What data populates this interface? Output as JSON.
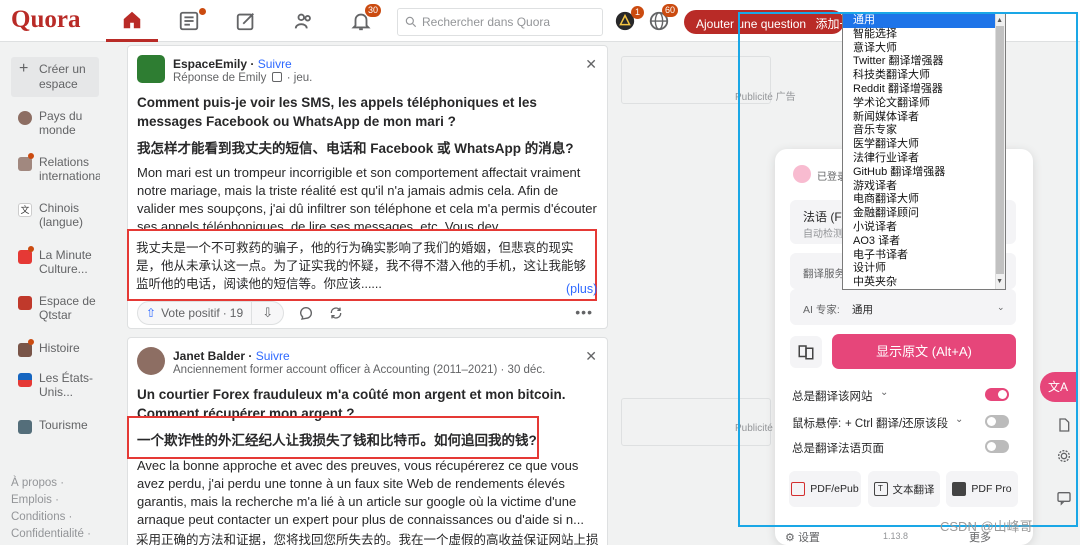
{
  "brand": {
    "logo": "Quora",
    "accent": "#b92b27"
  },
  "topnav": {
    "notif_badge": "30",
    "notif_badge_2": "1",
    "lang_badge": "60",
    "search_placeholder": "Rechercher dans Quora",
    "ask_label": "Ajouter une question",
    "ask_extra": "添加一"
  },
  "sidebar": {
    "create_space": "Créer un espace",
    "items": [
      {
        "label": "Pays du monde",
        "color": "#8d6e63"
      },
      {
        "label": "Relations internationales",
        "color": "#a1887f"
      },
      {
        "label": "Chinois (langue)",
        "color": "#ffffff"
      },
      {
        "label": "La Minute Culture...",
        "color": "#e53935"
      },
      {
        "label": "Espace de Qtstar",
        "color": "#c0392b"
      },
      {
        "label": "Histoire",
        "color": "#795548"
      },
      {
        "label": "Les États-Unis...",
        "color": "#1565c0"
      },
      {
        "label": "Tourisme",
        "color": "#546e7a"
      }
    ],
    "footer": [
      "À propos ·",
      "Emplois ·",
      "Conditions ·",
      "Confidentialité ·"
    ]
  },
  "post1": {
    "author": "EspaceEmily",
    "follow": "Suivre",
    "credential": "Réponse de Emily",
    "date": "· jeu.",
    "question_fr": "Comment puis-je voir les SMS, les appels téléphoniques et les messages Facebook ou WhatsApp de mon mari ?",
    "question_zh": "我怎样才能看到我丈夫的短信、电话和 Facebook 或 WhatsApp 的消息?",
    "body_fr": "Mon mari est un trompeur incorrigible et son comportement affectait vraiment notre mariage, mais la triste réalité est qu'il n'a jamais admis cela. Afin de valider mes soupçons, j'ai dû infiltrer son téléphone et cela m'a permis d'écouter ses appels téléphoniques, de lire ses messages, etc. Vous dev...",
    "body_zh": "我丈夫是一个不可救药的骗子，他的行为确实影响了我们的婚姻，但悲哀的现实是，他从未承认这一点。为了证实我的怀疑，我不得不潜入他的手机，这让我能够监听他的电话，阅读他的短信等。你应该......",
    "more": "(plus)",
    "vote_label": "Vote positif",
    "vote_count": "19"
  },
  "post2": {
    "author": "Janet Balder",
    "follow": "Suivre",
    "credential": "Anciennement former account officer à Accounting (2011–2021) · 30 déc.",
    "question_fr": "Un courtier Forex frauduleux m'a coûté mon argent et mon bitcoin. Comment récupérer mon argent ?",
    "question_zh": "一个欺诈性的外汇经纪人让我损失了钱和比特币。如何追回我的钱?",
    "body_fr": "Avec la bonne approche et avec des preuves, vous récupérerez ce que vous avez perdu, j'ai perdu une tonne à un faux site Web de rendements élevés garantis, mais la recherche m'a lié à un article sur google où la victime d'une arnaque peut contacter un expert pour plus de connaissances ou d'aide si n...",
    "body_zh": "采用正确的方法和证据，您将找回您所失去的。我在一个虚假的高收益保证网站上损"
  },
  "ads": {
    "label_1": "Publicité 广告",
    "label_2": "Publicité"
  },
  "translator": {
    "logged_in": "已登录",
    "source_lang": "法语 (Fr",
    "auto_detect": "自动检测",
    "service_label": "翻译服务",
    "ai_expert_label": "AI 专家:",
    "ai_expert_value": "通用",
    "show_original": "显示原文 (Alt+A)",
    "always_translate_site": "总是翻译该网站",
    "hover_label": "鼠标悬停:",
    "hover_value": "+ Ctrl 翻译/还原该段",
    "always_translate_fr": "总是翻译法语页面",
    "tools": [
      "PDF/ePub",
      "文本翻译",
      "PDF Pro"
    ],
    "settings": "设置",
    "version": "1.13.8",
    "more": "更多",
    "pink": "#e6467a"
  },
  "dropdown": {
    "selected": "通用",
    "options": [
      "通用",
      "智能选择",
      "意译大师",
      "Twitter 翻译增强器",
      "科技类翻译大师",
      "Reddit 翻译增强器",
      "学术论文翻译师",
      "新闻媒体译者",
      "音乐专家",
      "医学翻译大师",
      "法律行业译者",
      "GitHub 翻译增强器",
      "游戏译者",
      "电商翻译大师",
      "金融翻译顾问",
      "小说译者",
      "AO3 译者",
      "电子书译者",
      "设计师",
      "中英夹杂"
    ]
  },
  "floating": {
    "translate_icon_text": "文A"
  },
  "watermark": "CSDN @山峰哥"
}
